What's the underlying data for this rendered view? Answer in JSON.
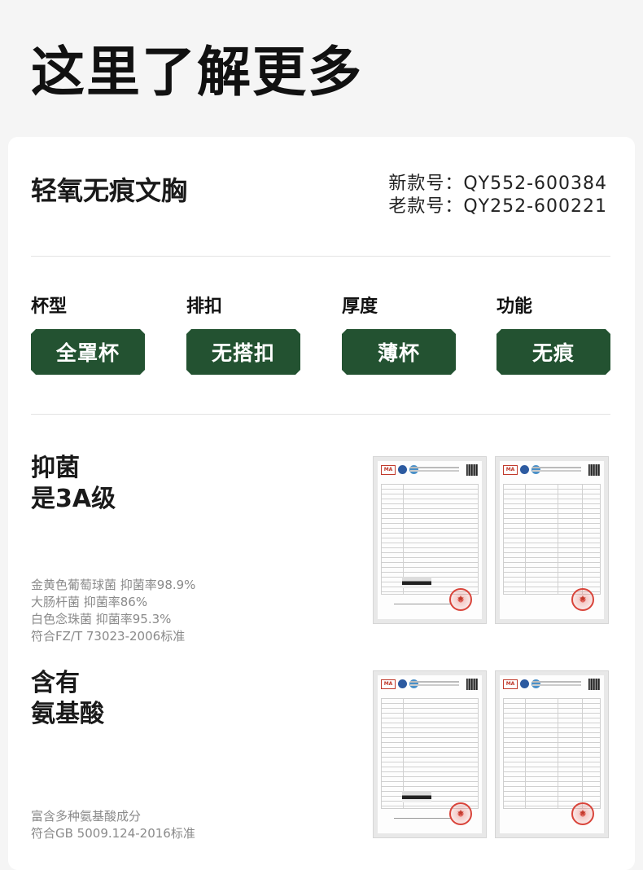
{
  "header": {
    "title": "这里了解更多"
  },
  "product": {
    "name": "轻氧无痕文胸",
    "new_code": "新款号：QY552-600384",
    "old_code": "老款号：QY252-600221"
  },
  "attributes": [
    {
      "label": "杯型",
      "value": "全罩杯"
    },
    {
      "label": "排扣",
      "value": "无搭扣"
    },
    {
      "label": "厚度",
      "value": "薄杯"
    },
    {
      "label": "功能",
      "value": "无痕"
    }
  ],
  "features": [
    {
      "title_line1": "抑菌",
      "title_line2": "是3A级",
      "desc": [
        "金黄色葡萄球菌 抑菌率98.9%",
        "大肠杆菌 抑菌率86%",
        "白色念珠菌 抑菌率95.3%",
        "符合FZ/T 73023-2006标准"
      ]
    },
    {
      "title_line1": "含有",
      "title_line2": "氨基酸",
      "desc": [
        "富含多种氨基酸成分",
        "符合GB 5009.124-2016标准"
      ]
    }
  ],
  "colors": {
    "accent": "#235231",
    "muted_text": "#8a8a8a"
  },
  "icons": {
    "cert_logo_1": "cma-logo",
    "cert_logo_2": "cnas-logo",
    "cert_stamp": "red-seal-stamp"
  }
}
